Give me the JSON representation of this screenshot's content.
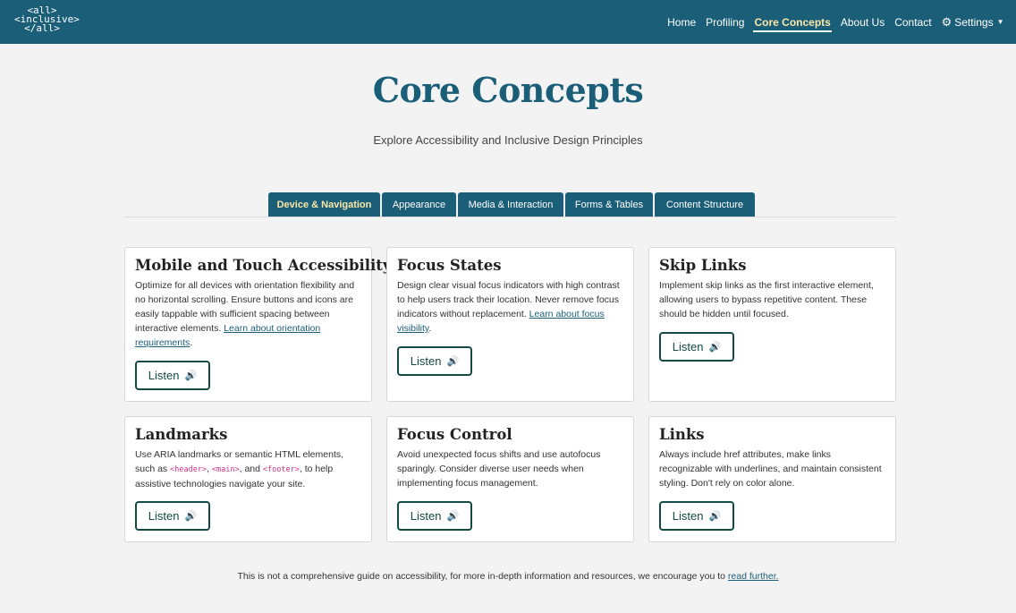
{
  "logo": {
    "line1": "<all>",
    "line2": "<inclusive>",
    "line3": "</all>"
  },
  "nav": {
    "items": [
      "Home",
      "Profiling",
      "Core Concepts",
      "About Us",
      "Contact"
    ],
    "settings_label": "Settings",
    "active": "Core Concepts"
  },
  "header": {
    "title": "Core Concepts",
    "subtitle": "Explore Accessibility and Inclusive Design Principles"
  },
  "tabs": [
    {
      "label": "Device & Navigation",
      "active": true
    },
    {
      "label": "Appearance",
      "active": false
    },
    {
      "label": "Media & Interaction",
      "active": false
    },
    {
      "label": "Forms & Tables",
      "active": false
    },
    {
      "label": "Content Structure",
      "active": false
    }
  ],
  "listen_label": "Listen",
  "cards": [
    {
      "title": "Mobile and Touch Accessibility",
      "text": "Optimize for all devices with orientation flexibility and no horizontal scrolling. Ensure buttons and icons are easily tappable with sufficient spacing between interactive elements.",
      "link": "Learn about orientation requirements",
      "after": "."
    },
    {
      "title": "Focus States",
      "text": "Design clear visual focus indicators with high contrast to help users track their location. Never remove focus indicators without replacement.",
      "link": "Learn about focus visibility",
      "after": "."
    },
    {
      "title": "Skip Links",
      "text": "Implement skip links as the first interactive element, allowing users to bypass repetitive content. These should be hidden until focused."
    },
    {
      "title": "Landmarks",
      "text_before": "Use ARIA landmarks or semantic HTML elements, such as",
      "code1": "<header>",
      "sep1": ",",
      "code2": "<main>",
      "sep2": ", and",
      "code3": "<footer>",
      "text_after": ", to help assistive technologies navigate your site."
    },
    {
      "title": "Focus Control",
      "text": "Avoid unexpected focus shifts and use autofocus sparingly. Consider diverse user needs when implementing focus management."
    },
    {
      "title": "Links",
      "text": "Always include href attributes, make links recognizable with underlines, and maintain consistent styling. Don't rely on color alone."
    }
  ],
  "footer": {
    "text": "This is not a comprehensive guide on accessibility, for more in-depth information and resources, we encourage you to",
    "link": "read further."
  },
  "colors": {
    "primary": "#1b5e78",
    "active_text": "#fbe7a8",
    "button_border": "#134a43",
    "background": "#f3f3f3"
  }
}
